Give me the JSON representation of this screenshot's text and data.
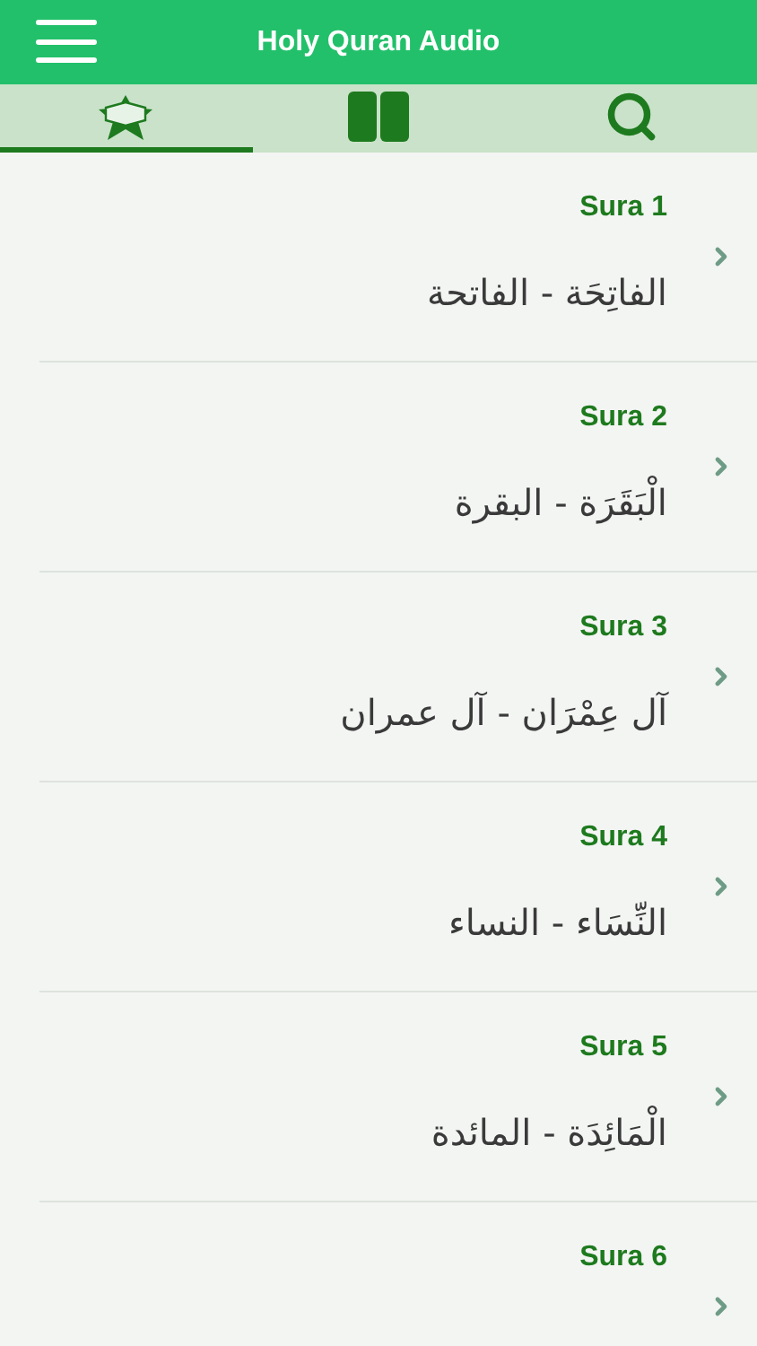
{
  "header": {
    "title": "Holy Quran Audio"
  },
  "tabs": [
    {
      "kind": "quran",
      "selected": true
    },
    {
      "kind": "book",
      "selected": false
    },
    {
      "kind": "search",
      "selected": false
    }
  ],
  "suras": [
    {
      "label": "Sura 1",
      "name": "الفاتِحَة - الفاتحة"
    },
    {
      "label": "Sura 2",
      "name": "الْبَقَرَة - البقرة"
    },
    {
      "label": "Sura 3",
      "name": "آل عِمْرَان - آل عمران"
    },
    {
      "label": "Sura 4",
      "name": "النِّسَاء - النساء"
    },
    {
      "label": "Sura 5",
      "name": "الْمَائِدَة - المائدة"
    },
    {
      "label": "Sura 6"
    }
  ]
}
